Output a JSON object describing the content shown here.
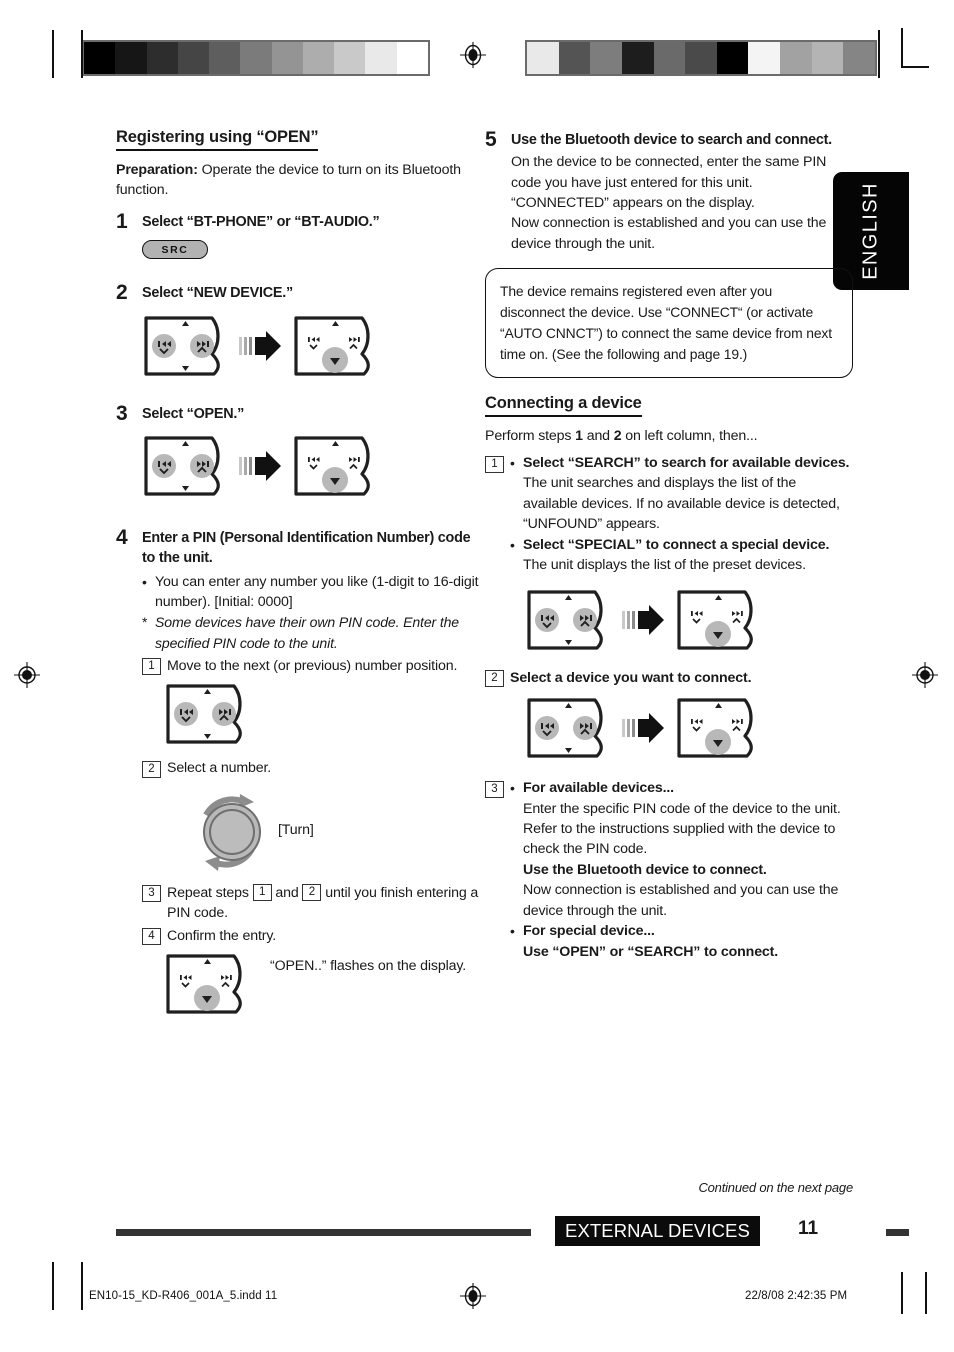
{
  "sidetab": {
    "label": "ENGLISH"
  },
  "left_column": {
    "heading": "Registering using “OPEN”",
    "preparation_label": "Preparation:",
    "preparation_text": " Operate the device to turn on its Bluetooth function.",
    "steps": [
      {
        "num": "1",
        "title": "Select “BT-PHONE” or “BT-AUDIO.”",
        "button_label": "SRC"
      },
      {
        "num": "2",
        "title": "Select “NEW DEVICE.”"
      },
      {
        "num": "3",
        "title": "Select “OPEN.”"
      },
      {
        "num": "4",
        "title": "Enter a PIN (Personal Identification Number) code to the unit.",
        "bullet": "You can enter any number you like (1-digit to 16-digit number). [Initial: 0000]",
        "asterisk": "Some devices have their own PIN code. Enter the specified PIN code to the unit.",
        "sub_1_num": "1",
        "sub_1_text": "Move to the next (or previous) number position.",
        "sub_2_num": "2",
        "sub_2_text": "Select a number.",
        "knob_label": "[Turn]",
        "sub_3_num": "3",
        "sub_3_text_a": "Repeat steps ",
        "sub_3_ref_a": "1",
        "sub_3_text_b": " and ",
        "sub_3_ref_b": "2",
        "sub_3_text_c": " until you finish entering a PIN code.",
        "sub_4_num": "4",
        "sub_4_text": "Confirm the entry.",
        "sub_4_note": "“OPEN..” flashes on the display."
      }
    ]
  },
  "right_column": {
    "step5": {
      "num": "5",
      "title": "Use the Bluetooth device to search and connect.",
      "lines": [
        "On the device to be connected, enter the same PIN code you have just entered for this unit.",
        "“CONNECTED” appears on the display.",
        "Now connection is established and you can use the device through the unit."
      ]
    },
    "notebox": "The device remains registered even after you disconnect the device. Use “CONNECT“ (or activate “AUTO CNNCT”) to connect the same device from next time on. (See the following and page 19.)",
    "heading": "Connecting a device",
    "intro_a": "Perform steps ",
    "intro_b1": "1",
    "intro_mid": " and ",
    "intro_b2": "2",
    "intro_c": " on left column, then...",
    "sub1": {
      "num": "1",
      "bullet1_title": "Select “SEARCH” to search for available devices.",
      "bullet1_body": "The unit searches and displays the list of the available devices. If no available device is detected, “UNFOUND” appears.",
      "bullet2_title": "Select “SPECIAL” to connect a special device.",
      "bullet2_body": "The unit displays the list of the preset devices."
    },
    "sub2": {
      "num": "2",
      "title": "Select a device you want to connect."
    },
    "sub3": {
      "num": "3",
      "bullet1_title": "For available devices...",
      "bullet1_body_a": "Enter the specific PIN code of the device to the unit.",
      "bullet1_body_b": "Refer to the instructions supplied with the device to check the PIN code.",
      "bullet1_bold": "Use the Bluetooth device to connect.",
      "bullet1_body_c": "Now connection is established and you can use the device through the unit.",
      "bullet2_title": "For special device...",
      "bullet2_bold": "Use “OPEN” or “SEARCH” to connect."
    }
  },
  "footer": {
    "continued": "Continued on the next page",
    "section": "EXTERNAL DEVICES",
    "page": "11",
    "filename": "EN10-15_KD-R406_001A_5.indd   11",
    "timestamp": "22/8/08   2:42:35 PM"
  },
  "colors": {
    "ink": "#1a1a1a",
    "panel_fill": "#ffffff",
    "panel_stroke": "#1a1a1a",
    "button_gray": "#b2b2b2",
    "chip_black": "#0b0b0b"
  }
}
